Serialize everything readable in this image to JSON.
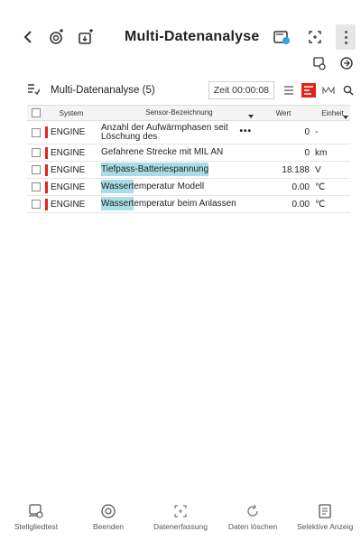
{
  "header": {
    "title": "Multi-Datenanalyse",
    "back_icon": "chevron-left-icon"
  },
  "toolbar": {
    "label": "Multi-Datenanalyse (5)",
    "time": "Zeit 00:00:08"
  },
  "table": {
    "columns": [
      "System",
      "Sensor-Bezeichnung",
      "Wert",
      "Einheit"
    ],
    "rows": [
      {
        "system": "ENGINE",
        "name": "Anzahl der Aufwärmphasen seit Löschung des",
        "value": "0",
        "unit": "-",
        "highlight": ""
      },
      {
        "system": "ENGINE",
        "name": "Gefahrene Strecke mit MIL AN",
        "value": "0",
        "unit": "km",
        "highlight": ""
      },
      {
        "system": "ENGINE",
        "name": "Tiefpass-Batteriespannung",
        "value": "18.188",
        "unit": "V",
        "highlight": "Tiefpass-Batteriespannung"
      },
      {
        "system": "ENGINE",
        "name_hl": "Wassert",
        "name_rest": "emperatur Modell",
        "value": "0.00",
        "unit": "℃"
      },
      {
        "system": "ENGINE",
        "name_hl": "Wassert",
        "name_rest": "emperatur beim Anlassen",
        "value": "0.00",
        "unit": "℃"
      }
    ],
    "more_glyph": "•••"
  },
  "bottom_nav": [
    {
      "label": "Stellgliedtest",
      "icon": "actuator-test-icon"
    },
    {
      "label": "Beenden",
      "icon": "stop-icon"
    },
    {
      "label": "Datenerfassung",
      "icon": "data-capture-icon"
    },
    {
      "label": "Daten löschen",
      "icon": "refresh-icon"
    },
    {
      "label": "Selektive Anzeig",
      "icon": "selective-display-icon"
    }
  ],
  "colors": {
    "accent": "#e2231a",
    "highlight": "#a8dde5"
  }
}
